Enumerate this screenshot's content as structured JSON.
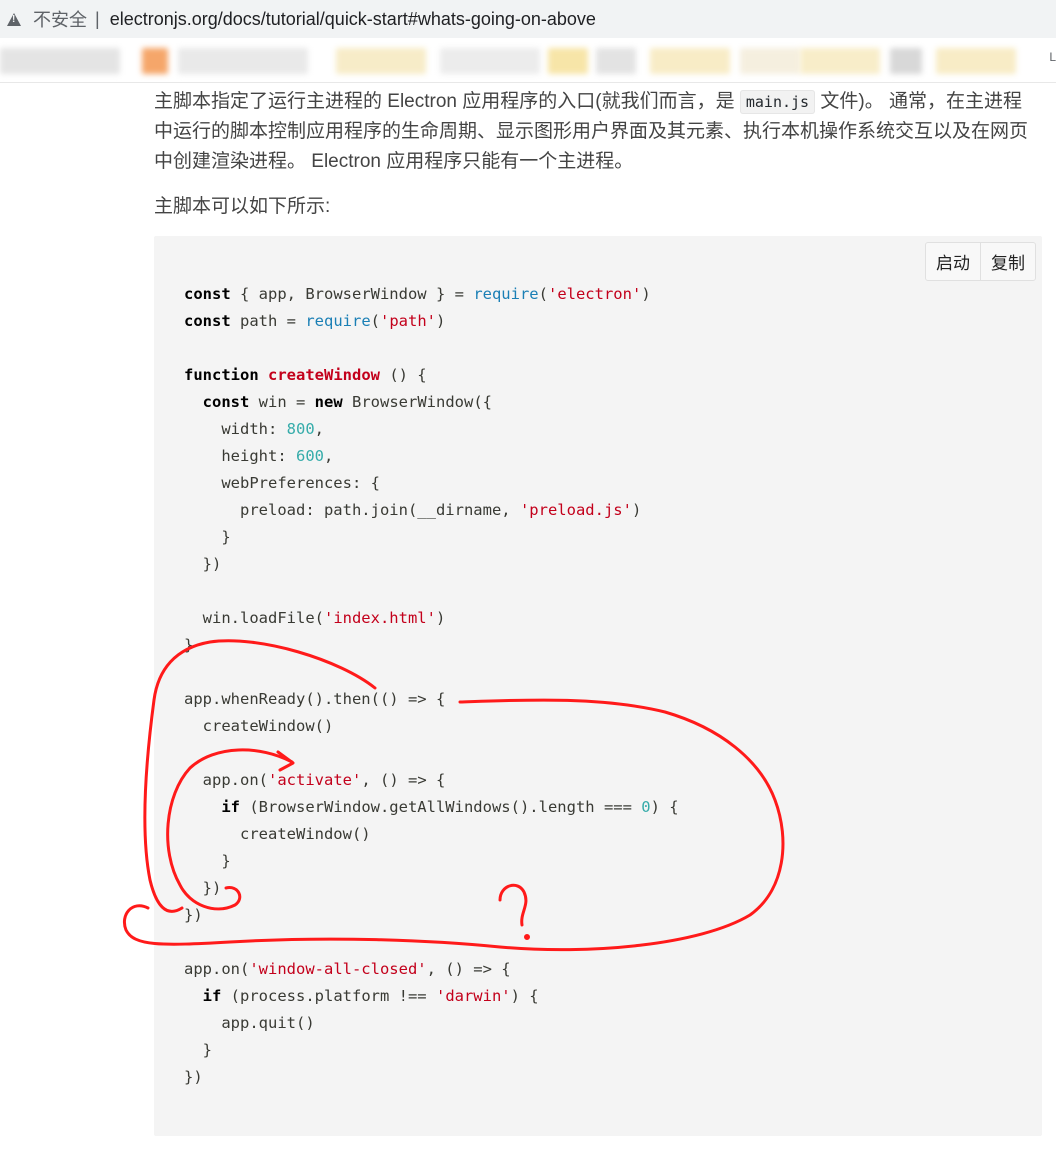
{
  "browser": {
    "security_label": "不安全",
    "divider": "|",
    "url": "electronjs.org/docs/tutorial/quick-start#whats-going-on-above",
    "bookmark_edge_char": "L"
  },
  "content": {
    "para1_a": "主脚本指定了运行主进程的 Electron 应用程序的入口(就我们而言，是 ",
    "para1_code": "main.js",
    "para1_b": " 文件)。 通常，在主进程中运行的脚本控制应用程序的生命周期、显示图形用户界面及其元素、执行本机操作系统交互以及在网页中创建渲染进程。 Electron 应用程序只能有一个主进程。",
    "para2": "主脚本可以如下所示:"
  },
  "code_toolbar": {
    "run_label": "启动",
    "copy_label": "复制"
  },
  "code": {
    "lines": [
      [
        {
          "k": "kw",
          "t": "const"
        },
        {
          "t": " { app, BrowserWindow } = "
        },
        {
          "k": "bi",
          "t": "require"
        },
        {
          "t": "("
        },
        {
          "k": "st",
          "t": "'electron'"
        },
        {
          "t": ")"
        }
      ],
      [
        {
          "k": "kw",
          "t": "const"
        },
        {
          "t": " path = "
        },
        {
          "k": "bi",
          "t": "require"
        },
        {
          "t": "("
        },
        {
          "k": "st",
          "t": "'path'"
        },
        {
          "t": ")"
        }
      ],
      [],
      [
        {
          "k": "kw",
          "t": "function"
        },
        {
          "t": " "
        },
        {
          "k": "fn",
          "t": "createWindow"
        },
        {
          "t": " () {"
        }
      ],
      [
        {
          "t": "  "
        },
        {
          "k": "kw",
          "t": "const"
        },
        {
          "t": " win = "
        },
        {
          "k": "kw",
          "t": "new"
        },
        {
          "t": " BrowserWindow({"
        }
      ],
      [
        {
          "t": "    width: "
        },
        {
          "k": "nu",
          "t": "800"
        },
        {
          "t": ","
        }
      ],
      [
        {
          "t": "    height: "
        },
        {
          "k": "nu",
          "t": "600"
        },
        {
          "t": ","
        }
      ],
      [
        {
          "t": "    webPreferences: {"
        }
      ],
      [
        {
          "t": "      preload: path.join(__dirname, "
        },
        {
          "k": "st",
          "t": "'preload.js'"
        },
        {
          "t": ")"
        }
      ],
      [
        {
          "t": "    }"
        }
      ],
      [
        {
          "t": "  })"
        }
      ],
      [],
      [
        {
          "t": "  win.loadFile("
        },
        {
          "k": "st",
          "t": "'index.html'"
        },
        {
          "t": ")"
        }
      ],
      [
        {
          "t": "}"
        }
      ],
      [],
      [
        {
          "t": "app.whenReady().then(() => {"
        }
      ],
      [
        {
          "t": "  createWindow()"
        }
      ],
      [],
      [
        {
          "t": "  app.on("
        },
        {
          "k": "st",
          "t": "'activate'"
        },
        {
          "t": ", () => {"
        }
      ],
      [
        {
          "t": "    "
        },
        {
          "k": "kw",
          "t": "if"
        },
        {
          "t": " (BrowserWindow.getAllWindows().length === "
        },
        {
          "k": "nu",
          "t": "0"
        },
        {
          "t": ") {"
        }
      ],
      [
        {
          "t": "      createWindow()"
        }
      ],
      [
        {
          "t": "    }"
        }
      ],
      [
        {
          "t": "  })"
        }
      ],
      [
        {
          "t": "})"
        }
      ],
      [],
      [
        {
          "t": "app.on("
        },
        {
          "k": "st",
          "t": "'window-all-closed'"
        },
        {
          "t": ", () => {"
        }
      ],
      [
        {
          "t": "  "
        },
        {
          "k": "kw",
          "t": "if"
        },
        {
          "t": " (process.platform !== "
        },
        {
          "k": "st",
          "t": "'darwin'"
        },
        {
          "t": ") {"
        }
      ],
      [
        {
          "t": "    app.quit()"
        }
      ],
      [
        {
          "t": "  }"
        }
      ],
      [
        {
          "t": "})"
        }
      ]
    ]
  },
  "colors": {
    "annotation": "#ff1a1a",
    "keyword": "#000000",
    "function_name": "#c3001b",
    "builtin": "#1a7fb5",
    "string": "#c3001b",
    "number": "#36acaa",
    "code_background": "#f4f4f4"
  },
  "icons": {
    "security": "warning-triangle-icon"
  }
}
